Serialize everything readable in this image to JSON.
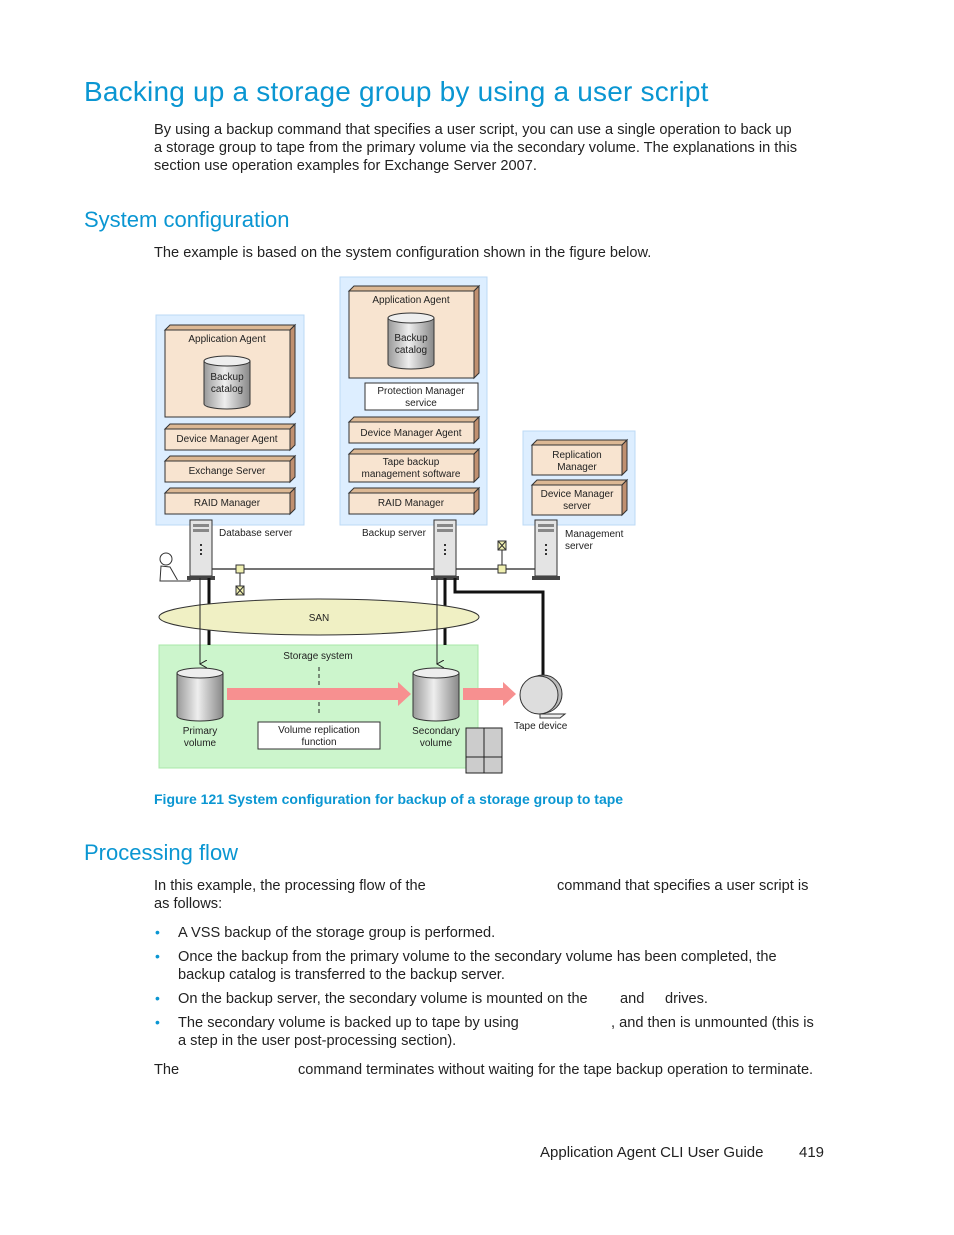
{
  "title": "Backing up a storage group by using a user script",
  "intro": [
    "By using a backup command that specifies a user script, you can use a single operation to back up",
    "a storage group to tape from the primary volume via the secondary volume. The explanations in this",
    "section use operation examples for Exchange Server 2007."
  ],
  "system_configuration": {
    "heading": "System configuration",
    "text": "The example is based on the system configuration shown in the figure below.",
    "figure": {
      "caption": "Figure 121 System configuration for backup of a storage group to tape",
      "database_server": {
        "label": "Database server",
        "application_agent": "Application Agent",
        "catalog": [
          "Backup",
          "catalog"
        ],
        "device_manager_agent": "Device Manager Agent",
        "exchange_server": "Exchange Server",
        "raid_manager": "RAID Manager"
      },
      "backup_server": {
        "label": "Backup server",
        "application_agent": "Application Agent",
        "catalog": [
          "Backup",
          "catalog"
        ],
        "protection_manager": [
          "Protection Manager",
          "service"
        ],
        "device_manager_agent": "Device Manager Agent",
        "tape_backup": [
          "Tape backup",
          "management software"
        ],
        "raid_manager": "RAID Manager"
      },
      "management_server": {
        "label": [
          "Management",
          "server"
        ],
        "replication_manager": [
          "Replication",
          "Manager"
        ],
        "device_manager_server": [
          "Device Manager",
          "server"
        ]
      },
      "san": "SAN",
      "storage_system": "Storage system",
      "primary_volume": [
        "Primary",
        "volume"
      ],
      "secondary_volume": [
        "Secondary",
        "volume"
      ],
      "volume_replication": [
        "Volume replication",
        "function"
      ],
      "tape_device": "Tape device",
      "colors": {
        "server_panel": "#ddeeff",
        "component": "#f8e4d0",
        "storage": "#ccf5cc",
        "san": "#f0f0c4",
        "arrow": "#f79090"
      }
    }
  },
  "processing_flow": {
    "heading": "Processing flow",
    "intro_a": "In this example, the processing flow of the",
    "intro_b": "command that specifies a user script is",
    "intro_c": "as follows:",
    "steps": [
      {
        "lines": [
          "A VSS backup of the storage group is performed."
        ]
      },
      {
        "lines": [
          "Once the backup from the primary volume to the secondary volume has been completed, the",
          "backup catalog is transferred to the backup server."
        ]
      },
      {
        "parts": [
          "On the backup server, the secondary volume is mounted on the",
          "and",
          "drives."
        ]
      },
      {
        "parts": [
          "The secondary volume is backed up to tape by using",
          ", and then is unmounted (this is"
        ],
        "line2": "a step in the user post-processing section)."
      }
    ],
    "closing_a": "The",
    "closing_b": "command terminates without waiting for the tape backup operation to terminate."
  },
  "footer": {
    "guide": "Application Agent CLI User Guide",
    "page": "419"
  }
}
